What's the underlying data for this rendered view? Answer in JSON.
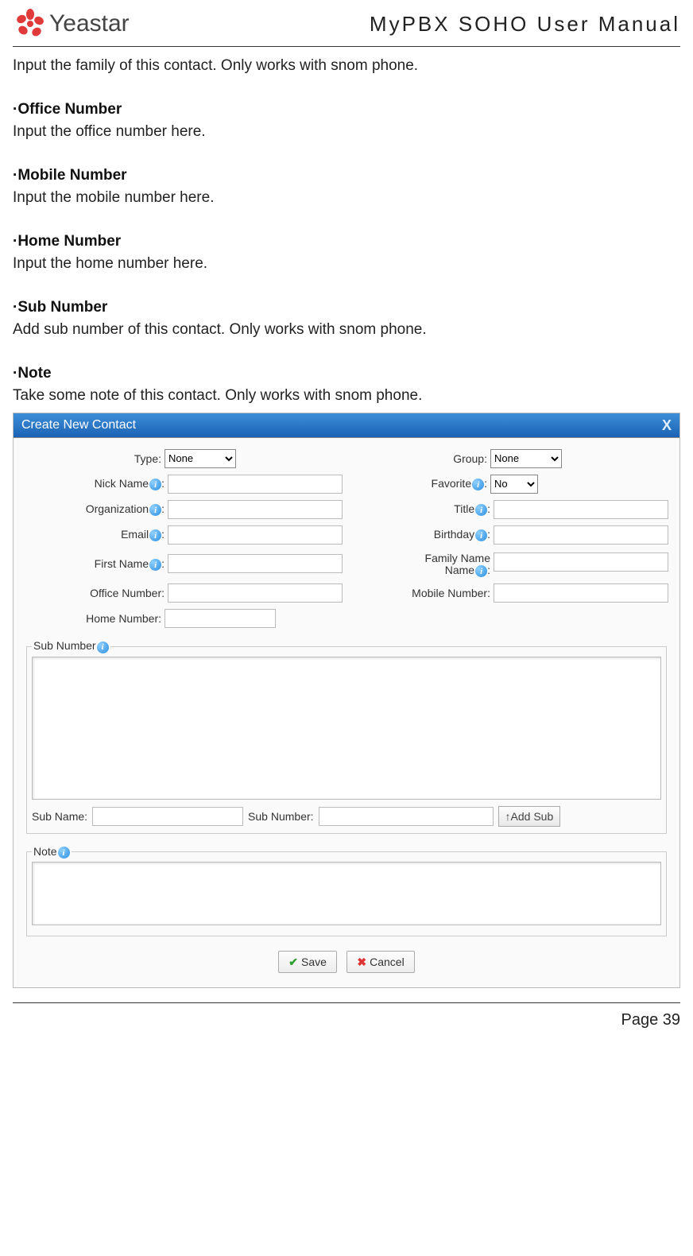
{
  "header": {
    "logo_text": "Yeastar",
    "doc_title": "MyPBX SOHO User Manual"
  },
  "intro_line": "Input the family of this contact. Only works with snom phone.",
  "sections": {
    "office": {
      "title": "·Office Number",
      "desc": "Input the office number here."
    },
    "mobile": {
      "title": "·Mobile Number",
      "desc": "Input the mobile number here."
    },
    "home": {
      "title": "·Home Number",
      "desc": "Input the home number here."
    },
    "sub": {
      "title": "·Sub Number",
      "desc": "Add sub number of this contact. Only works with snom phone."
    },
    "note": {
      "title": "·Note",
      "desc": "Take some note of this contact. Only works with snom phone."
    }
  },
  "dialog": {
    "title": "Create New Contact",
    "close": "X",
    "labels": {
      "type": "Type:",
      "group": "Group:",
      "nickname": "Nick Name",
      "favorite": "Favorite",
      "organization": "Organization",
      "title": "Title",
      "email": "Email",
      "birthday": "Birthday",
      "firstname": "First Name",
      "familyname": "Family Name",
      "officenum": "Office Number:",
      "mobilenum": "Mobile Number:",
      "homenum": "Home Number:",
      "subnumber_legend": "Sub Number",
      "subname": "Sub Name:",
      "subnum": "Sub Number:",
      "addsub": "↑Add Sub",
      "note_legend": "Note",
      "colon": ":"
    },
    "selects": {
      "type_value": "None",
      "group_value": "None",
      "favorite_value": "No"
    },
    "buttons": {
      "save": "Save",
      "cancel": "Cancel"
    }
  },
  "footer": {
    "page": "Page 39"
  }
}
